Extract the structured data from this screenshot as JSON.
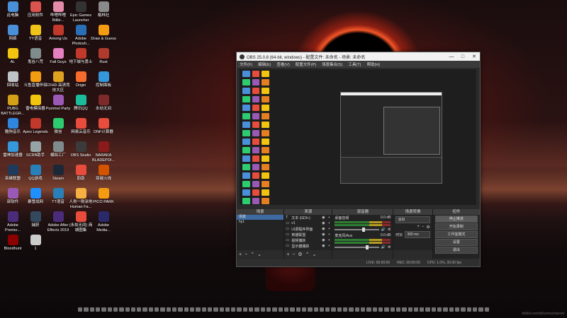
{
  "desktop": {
    "icons": [
      {
        "label": "此电脑",
        "color": "#4a90d9"
      },
      {
        "label": "应用软件",
        "color": "#d9534f"
      },
      {
        "label": "哔哩哔哩 Bilibi...",
        "color": "#e58aa8"
      },
      {
        "label": "Epic Games Launcher",
        "color": "#333333"
      },
      {
        "label": "格林社",
        "color": "#8a8a8a"
      },
      {
        "label": "网络",
        "color": "#4a90d9"
      },
      {
        "label": "YY语音",
        "color": "#f0c419"
      },
      {
        "label": "Among Us",
        "color": "#c0392b"
      },
      {
        "label": "Adobe Photosh...",
        "color": "#2a6fb5"
      },
      {
        "label": "Draw & Guess",
        "color": "#f39c12"
      },
      {
        "label": "AL",
        "color": "#f1c40f"
      },
      {
        "label": "鬼谷八荒",
        "color": "#7f8c8d"
      },
      {
        "label": "Fall Guys",
        "color": "#e67ec2"
      },
      {
        "label": "地下城与勇士",
        "color": "#c0392b"
      },
      {
        "label": "Rust",
        "color": "#b03a2e"
      },
      {
        "label": "回收站",
        "color": "#bdc3c7"
      },
      {
        "label": "斗鱼直播伴侣",
        "color": "#f39c12"
      },
      {
        "label": "CFHD 高清竞技大区",
        "color": "#e0a020"
      },
      {
        "label": "Origin",
        "color": "#f56c2d"
      },
      {
        "label": "控制面板",
        "color": "#3498db"
      },
      {
        "label": "PUBG BATTLEGR...",
        "color": "#d4a017"
      },
      {
        "label": "雷电模拟器",
        "color": "#f1c40f"
      },
      {
        "label": "Pummel Party",
        "color": "#9b59b6"
      },
      {
        "label": "腾讯QQ",
        "color": "#1abc9c"
      },
      {
        "label": "永劫无间",
        "color": "#7f2a2a"
      },
      {
        "label": "酷狗音乐",
        "color": "#2e86de"
      },
      {
        "label": "Apex Legends",
        "color": "#c0392b"
      },
      {
        "label": "微信",
        "color": "#2ecc71"
      },
      {
        "label": "网易云音乐",
        "color": "#e74c3c"
      },
      {
        "label": "DNF计算器",
        "color": "#e74c3c"
      },
      {
        "label": "雷神加速器",
        "color": "#3498db"
      },
      {
        "label": "SCRB助手",
        "color": "#95a5a6"
      },
      {
        "label": "模拟工厂",
        "color": "#7f8c8d"
      },
      {
        "label": "OBS Studio",
        "color": "#3b3b3b"
      },
      {
        "label": "NARAKA BLADEPOI...",
        "color": "#8b1a1a"
      },
      {
        "label": "英雄联盟",
        "color": "#1f3a5a"
      },
      {
        "label": "QQ游戏",
        "color": "#2980b9"
      },
      {
        "label": "Steam",
        "color": "#1b2838"
      },
      {
        "label": "助助",
        "color": "#e74c3c"
      },
      {
        "label": "穿越火线",
        "color": "#d35400"
      },
      {
        "label": "部软件",
        "color": "#9b59b6"
      },
      {
        "label": "暴雪战网",
        "color": "#1e90ff"
      },
      {
        "label": "TT语音",
        "color": "#2980b9"
      },
      {
        "label": "人类一败涂地 Human Fa...",
        "color": "#f5b041"
      },
      {
        "label": "PICO PARK",
        "color": "#f39c12"
      },
      {
        "label": "Adobe Premie...",
        "color": "#4b2c7a"
      },
      {
        "label": "捕获",
        "color": "#34495e"
      },
      {
        "label": "Adobe After Effects 2019",
        "color": "#4b2c7a"
      },
      {
        "label": "(永劫无间) 商城图集",
        "color": "#e74c3c"
      },
      {
        "label": "Adobe Media...",
        "color": "#2a2a6a"
      },
      {
        "label": "Bloodhunt",
        "color": "#8b0000"
      },
      {
        "label": "1",
        "color": "#cccccc"
      }
    ]
  },
  "obs": {
    "title": "OBS 25.0.8 (64-bit, windows) - 配置文件: 未命名 - 场景: 未命名",
    "window_buttons": [
      "—",
      "□",
      "✕"
    ],
    "menu": [
      "文件(F)",
      "编辑(E)",
      "查看(V)",
      "配置文件(P)",
      "场景集合(S)",
      "工具(T)",
      "帮助(H)"
    ],
    "docks": {
      "scenes": {
        "title": "场景",
        "items": [
          "场景",
          "hy1"
        ]
      },
      "sources": {
        "title": "来源",
        "items": [
          "文本 (GDI+)",
          "v1",
          "UI源程序界面",
          "英雄联盟",
          "视频捕获",
          "显示器捕获"
        ]
      },
      "mixer": {
        "title": "混音器",
        "channels": [
          {
            "name": "桌面音频",
            "db": "0.0 dB",
            "level": 0.62
          },
          {
            "name": "麦克风/Aux",
            "db": "0.0 dB",
            "level": 0.7
          }
        ]
      },
      "transitions": {
        "title": "场景转换",
        "type": "淡出",
        "duration_label": "时长",
        "duration_value": "300 ms"
      },
      "controls": {
        "title": "控件",
        "buttons": [
          "停止推流",
          "开始录制",
          "工作室模式",
          "设置",
          "退出"
        ]
      }
    },
    "status": {
      "dropped": "LIVE: 00:00:00",
      "rec": "REC: 00:00:00",
      "cpu": "CPU: 1.0%, 30.00 fps"
    }
  },
  "watermark": "bilibili.com/id/somechannel"
}
